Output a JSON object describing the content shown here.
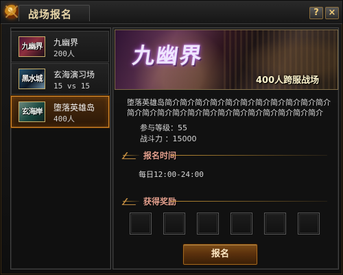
{
  "window": {
    "title": "战场报名",
    "help_label": "?",
    "close_label": "×"
  },
  "sidebar": {
    "items": [
      {
        "thumb_label": "九幽界",
        "name": "九幽界",
        "subtext": "200人"
      },
      {
        "thumb_label": "黑水城",
        "name": "玄海演习场",
        "subtext": "15 vs 15"
      },
      {
        "thumb_label": "玄海岸",
        "name": "堕落英雄岛",
        "subtext": "400人"
      }
    ]
  },
  "detail": {
    "banner_title": "九幽界",
    "banner_subtitle": "400人跨服战场",
    "description": "堕落英雄岛简介简介简介简介简介简介简介简介简介简介简介简介简介简介简介简介简介简介简介简介简介简介简介简介",
    "level_text": "参与等级：55",
    "power_text": "战斗力  ：15000",
    "signup_time_title": "报名时间",
    "signup_time_value": "每日12:00-24:00",
    "reward_title": "获得奖励",
    "signup_button_label": "报名"
  },
  "colors": {
    "accent_gold": "#d6a04a",
    "selected_border": "#d78b2b",
    "section_title": "#e3a08e",
    "button_orange": "#7b4b17"
  },
  "icons": {
    "title_ornament": "ornament-icon",
    "help": "help-icon",
    "close": "close-icon"
  }
}
